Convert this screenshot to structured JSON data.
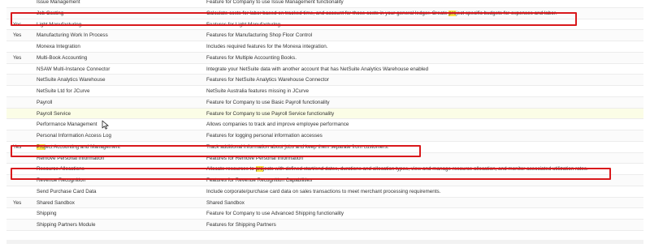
{
  "rows": [
    {
      "enabled": "",
      "name": "Issue Management",
      "desc": "Feature for Company to use Issue Management functionality"
    },
    {
      "enabled": "",
      "name": "Job Costing",
      "desc_pre": "Calculate costs for labor based on tracked time, and account for those costs in your general ledger. Create ",
      "desc_hl": "pro",
      "desc_post": "ject specific budgets for expenses and labor."
    },
    {
      "enabled": "Yes",
      "name": "Light Manufacturing",
      "desc": "Features for Light Manufacturing"
    },
    {
      "enabled": "Yes",
      "name": "Manufacturing Work In Process",
      "desc": "Features for Manufacturing Shop Floor Control"
    },
    {
      "enabled": "",
      "name": "Monexa Integration",
      "desc": "Includes required features for the Monexa integration."
    },
    {
      "enabled": "Yes",
      "name": "Multi-Book Accounting",
      "desc": "Features for Multiple Accounting Books."
    },
    {
      "enabled": "",
      "name": "NSAW Multi-Instance Connector",
      "desc": "Integrate your NetSuite data with another account that has NetSuite Analytics Warehouse enabled"
    },
    {
      "enabled": "",
      "name": "NetSuite Analytics Warehouse",
      "desc": "Features for NetSuite Analytics Warehouse Connector"
    },
    {
      "enabled": "",
      "name": "NetSuite Ltd for JCurve",
      "desc": "NetSuite Australia features missing in JCurve"
    },
    {
      "enabled": "",
      "name": "Payroll",
      "desc": "Feature for Company to use Basic Payroll functionality"
    },
    {
      "enabled": "",
      "name": "Payroll Service",
      "desc": "Feature for Company to use Payroll Service functionality"
    },
    {
      "enabled": "",
      "name": "Performance Management",
      "desc": "Allows companies to track and improve employee performance"
    },
    {
      "enabled": "",
      "name": "Personal Information Access Log",
      "desc": "Features for logging personal information accesses"
    },
    {
      "enabled": "Yes",
      "name_hl": "Pro",
      "name_post": "ject Accounting and Management",
      "desc": "Track additional information about jobs and keep them separate from customers."
    },
    {
      "enabled": "",
      "name": "Remove Personal Information",
      "desc": "Features for Remove Personal Information"
    },
    {
      "enabled": "",
      "name": "Resource Allocations",
      "desc_pre": "Allocate resources to ",
      "desc_hl": "pro",
      "desc_post": "jects with defined start/end dates, durations and allocation types, view and manage resource allocation, and monitor associated utilization rates."
    },
    {
      "enabled": "",
      "name": "Revenue Recognition",
      "desc": "Features for Revenue Recognition Capabilities"
    },
    {
      "enabled": "",
      "name": "Send Purchase Card Data",
      "desc": "Include corporate/purchase card data on sales transactions to meet merchant processing requirements."
    },
    {
      "enabled": "Yes",
      "name": "Shared Sandbox",
      "desc": "Shared Sandbox"
    },
    {
      "enabled": "",
      "name": "Shipping",
      "desc": "Feature for Company to use Advanced Shipping functionality"
    },
    {
      "enabled": "",
      "name": "Shipping Partners Module",
      "desc": "Features for Shipping Partners"
    }
  ],
  "colors": {
    "highlight_box": "#d9191c",
    "search_highlight": "#ffe34a",
    "hover_row": "#fbfde6"
  },
  "icons": {
    "cursor": "mouse-pointer-icon"
  }
}
